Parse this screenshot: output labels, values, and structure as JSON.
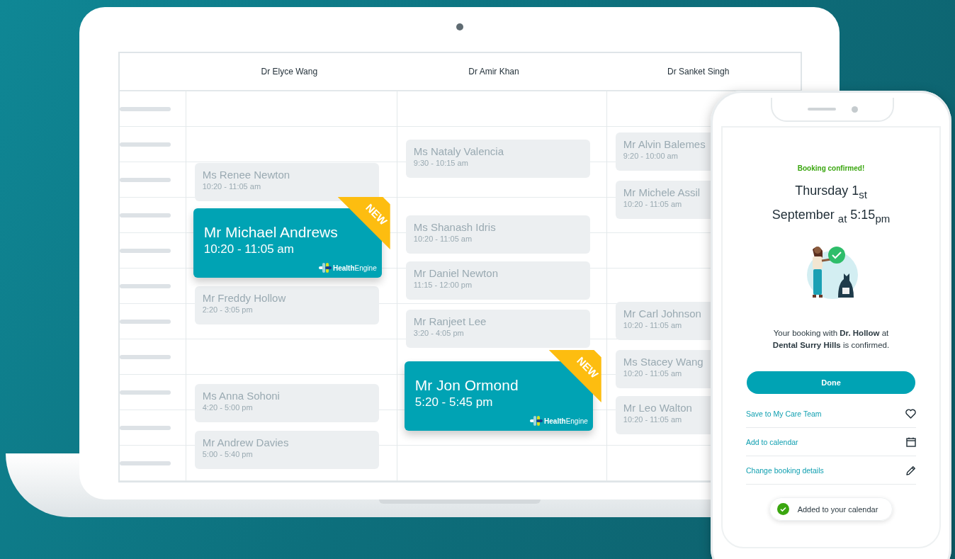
{
  "calendar": {
    "columns": [
      {
        "doctor": "Dr Elyce Wang",
        "appointments": [
          {
            "name": "Ms Renee Newton",
            "time": "10:20 - 11:05 am",
            "featured": false
          },
          {
            "name": "Mr Michael Andrews",
            "time": "10:20 - 11:05 am",
            "featured": true,
            "badge": "NEW",
            "logo": "**Health**Engine"
          },
          {
            "name": "Mr Freddy Hollow",
            "time": "2:20 - 3:05 pm",
            "featured": false
          },
          {
            "name": "Ms Anna Sohoni",
            "time": "4:20 - 5:00 pm",
            "featured": false
          },
          {
            "name": "Mr Andrew Davies",
            "time": "5:00 - 5:40 pm",
            "featured": false
          }
        ]
      },
      {
        "doctor": "Dr Amir Khan",
        "appointments": [
          {
            "name": "Ms Nataly Valencia",
            "time": "9:30 - 10:15 am",
            "featured": false
          },
          {
            "name": "Ms Shanash Idris",
            "time": "10:20 - 11:05 am",
            "featured": false
          },
          {
            "name": "Mr Daniel Newton",
            "time": "11:15 - 12:00 pm",
            "featured": false
          },
          {
            "name": "Mr Ranjeet Lee",
            "time": "3:20 - 4:05 pm",
            "featured": false
          },
          {
            "name": "Mr Jon Ormond",
            "time": "5:20 - 5:45 pm",
            "featured": true,
            "badge": "NEW",
            "logo": "**Health**Engine"
          }
        ]
      },
      {
        "doctor": "Dr Sanket Singh",
        "appointments": [
          {
            "name": "Mr Alvin Balemes",
            "time": "9:20 - 10:00 am",
            "featured": false
          },
          {
            "name": "Mr Michele Assil",
            "time": "10:20 - 11:05 am",
            "featured": false
          },
          {
            "name": "Mr Carl Johnson",
            "time": "10:20 - 11:05 am",
            "featured": false
          },
          {
            "name": "Ms Stacey Wang",
            "time": "10:20 - 11:05 am",
            "featured": false
          },
          {
            "name": "Mr Leo Walton",
            "time": "10:20 - 11:05 am",
            "featured": false
          }
        ]
      }
    ]
  },
  "phone": {
    "status": "Booking confirmed!",
    "date_line_1": "Thursday 1$_{st}$",
    "date_line_2": "September $_{at}$ 5:15$_{pm}$",
    "message": "Your booking with **Dr. Hollow** at **Dental Surry Hills** is confirmed.",
    "button": "Done",
    "actions": [
      {
        "label": "Save to My Care Team",
        "kind": "heart"
      },
      {
        "label": "Add to calendar",
        "kind": "calendar"
      },
      {
        "label": "Change booking details",
        "kind": "pencil"
      }
    ],
    "toast": "Added to your calendar"
  }
}
